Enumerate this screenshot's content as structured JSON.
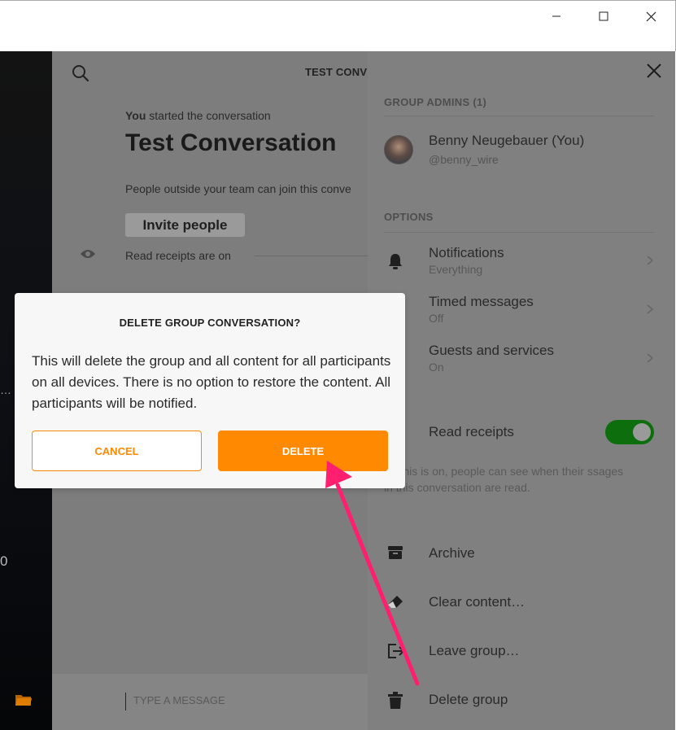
{
  "window": {
    "controls": [
      "minimize-icon",
      "maximize-icon",
      "close-icon"
    ]
  },
  "sidebar": {
    "ellipsis": "…",
    "partial_number": "0"
  },
  "conversation": {
    "header_title": "TEST CONV",
    "started_by": "You",
    "started_text": " started the conversation",
    "title": "Test Conversation",
    "guest_text": "People outside your team can join this conve",
    "invite_label": "Invite people",
    "receipts_text": "Read receipts are on",
    "composer_placeholder": "TYPE A MESSAGE"
  },
  "details": {
    "admins_heading": "GROUP ADMINS (1)",
    "admin": {
      "name": "Benny Neugebauer (You)",
      "handle": "@benny_wire"
    },
    "options_heading": "OPTIONS",
    "options": [
      {
        "label": "Notifications",
        "value": "Everything"
      },
      {
        "label": "Timed messages",
        "value": "Off"
      },
      {
        "label": "Guests and services",
        "value": "On"
      }
    ],
    "read_receipts": {
      "label": "Read receipts",
      "enabled": true,
      "description": "en this is on, people can see when their ssages in this conversation are read."
    },
    "actions": [
      {
        "label": "Archive",
        "icon": "archive-icon"
      },
      {
        "label": "Clear content…",
        "icon": "eraser-icon"
      },
      {
        "label": "Leave group…",
        "icon": "leave-icon"
      },
      {
        "label": "Delete group",
        "icon": "trash-icon"
      }
    ]
  },
  "modal": {
    "title": "DELETE GROUP CONVERSATION?",
    "message": "This will delete the group and all content for all participants on all devices. There is no option to restore the content. All participants will be notified.",
    "cancel_label": "CANCEL",
    "delete_label": "DELETE"
  },
  "colors": {
    "accent": "#ff8900",
    "toggle_on": "#0c6e0c",
    "annotation_arrow": "#ff1f6e"
  }
}
